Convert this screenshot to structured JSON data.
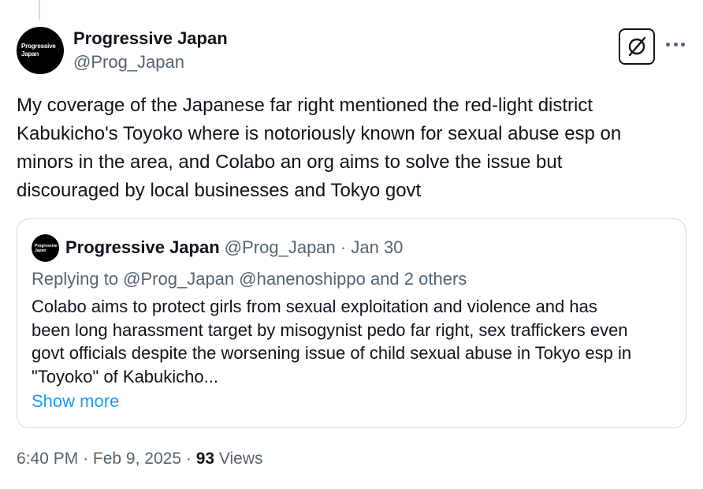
{
  "post": {
    "author": {
      "avatar_text_line1": "Progressive",
      "avatar_text_line2": "Japan",
      "name": "Progressive Japan",
      "handle": "@Prog_Japan"
    },
    "text": "My coverage of the Japanese far right mentioned the red-light district\nKabukicho's Toyoko where is notoriously known for sexual abuse esp on\nminors in the area, and Colabo an org aims to solve the issue but\ndiscouraged by local businesses and Tokyo govt",
    "grok_icon": "grok-icon",
    "more_icon": "more-dots-icon"
  },
  "quote": {
    "avatar_text_line1": "Progressive",
    "avatar_text_line2": "Japan",
    "name": "Progressive Japan",
    "handle": "@Prog_Japan",
    "separator": "·",
    "date": "Jan 30",
    "replying_to": "Replying to @Prog_Japan @hanenoshippo and 2 others",
    "text": "Colabo aims to protect girls from sexual exploitation and violence and has\nbeen long harassment target by misogynist pedo far right, sex traffickers even\ngovt officials despite the worsening issue of child sexual abuse in Tokyo esp in\n\"Toyoko\" of Kabukicho...",
    "show_more": "Show more"
  },
  "meta": {
    "time": "6:40 PM",
    "separator": "·",
    "date": "Feb 9, 2025",
    "views_count": "93",
    "views_label": "Views"
  },
  "colors": {
    "text": "#0f1419",
    "secondary": "#536471",
    "link": "#1d9bf0",
    "border": "#cfd9de"
  }
}
